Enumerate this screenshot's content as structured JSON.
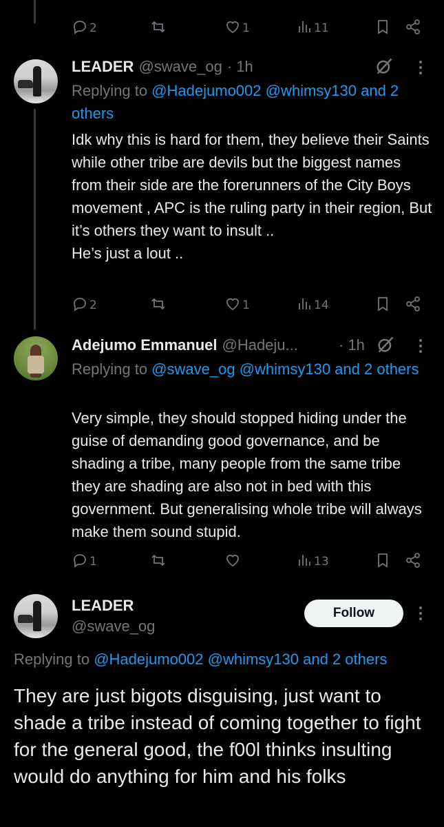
{
  "top_actions": {
    "replies": "2",
    "reposts": "",
    "likes": "1",
    "views": "11"
  },
  "tweet1": {
    "name": "LEADER",
    "handle": "@swave_og",
    "time": "· 1h",
    "replying_prefix": "Replying to ",
    "replying_mentions": "@Hadejumo002 @whimsy130 and 2 others",
    "body": "Idk why this is hard for them, they believe their Saints while other tribe are devils but the biggest names from their side are the forerunners of the City Boys movement , APC is the ruling party in their region, But it’s others they want to insult ..\nHe’s just a lout ..",
    "actions": {
      "replies": "2",
      "reposts": "",
      "likes": "1",
      "views": "14"
    }
  },
  "tweet2": {
    "name": "Adejumo Emmanuel",
    "handle": "@Hadeju...",
    "time": "· 1h",
    "replying_prefix": "Replying to ",
    "replying_mentions": "@swave_og @whimsy130 and 2 others",
    "body": "Very simple, they should stopped hiding under the guise of demanding good governance, and be shading a tribe, many people from the same tribe they are shading are also not in bed with this government. But generalising whole tribe will always make them sound stupid.",
    "actions": {
      "replies": "1",
      "reposts": "",
      "likes": "",
      "views": "13"
    }
  },
  "main_tweet": {
    "name": "LEADER",
    "handle": "@swave_og",
    "follow_label": "Follow",
    "replying_prefix": "Replying to ",
    "replying_mentions": "@Hadejumo002 @whimsy130 and 2 others",
    "body": "They are just bigots disguising, just want to shade a tribe instead of coming together to fight for the general good, the f00l thinks insulting would do anything for him and his folks"
  },
  "colors": {
    "background": "#000000",
    "text": "#e7e9ea",
    "muted": "#71767b",
    "accent": "#1d9bf0",
    "follow_bg": "#eff3f4"
  }
}
